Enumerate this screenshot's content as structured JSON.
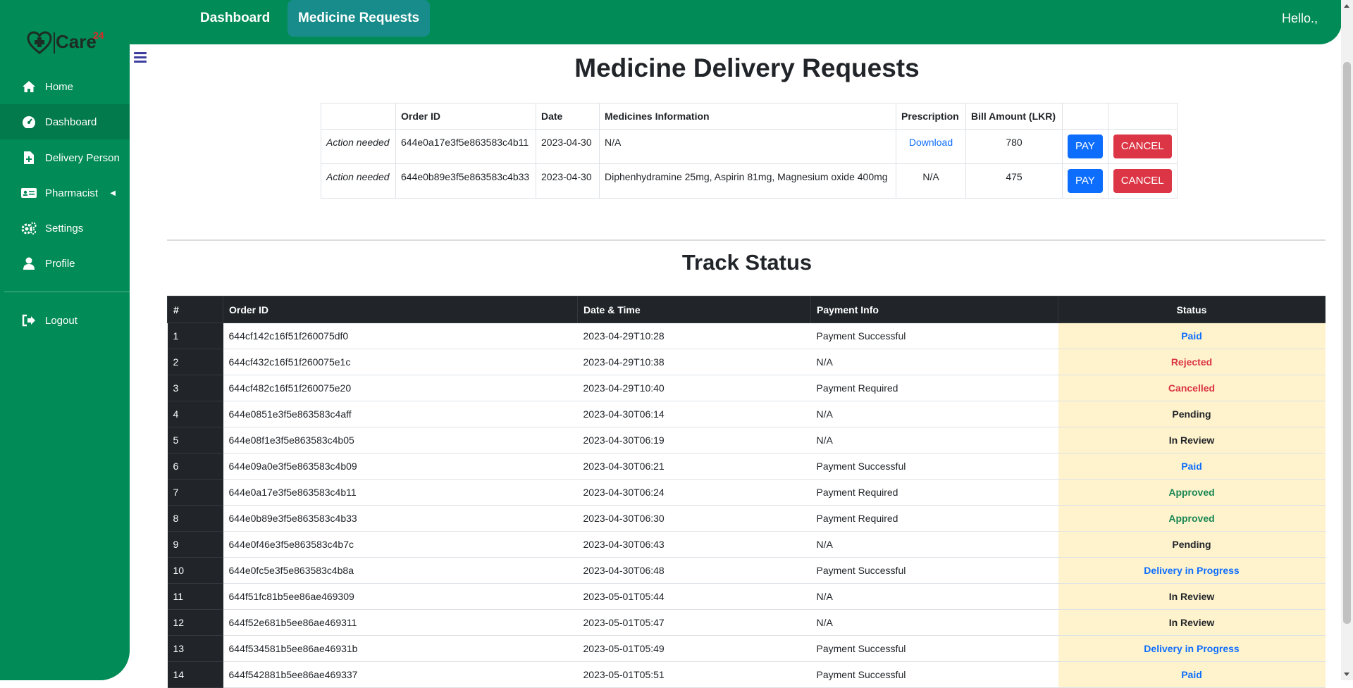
{
  "topnav": {
    "tabs": [
      "Dashboard",
      "Medicine Requests"
    ],
    "greeting": "Hello.,"
  },
  "brand": {
    "name": "Care",
    "suffix": "24"
  },
  "sidebar": {
    "items": [
      {
        "label": "Home",
        "icon": "home-icon"
      },
      {
        "label": "Dashboard",
        "icon": "dashboard-icon"
      },
      {
        "label": "Delivery Person",
        "icon": "file-plus-icon"
      },
      {
        "label": "Pharmacist",
        "icon": "id-card-icon"
      },
      {
        "label": "Settings",
        "icon": "gears-icon"
      },
      {
        "label": "Profile",
        "icon": "user-icon"
      }
    ],
    "logout": "Logout"
  },
  "page": {
    "title": "Medicine Delivery Requests"
  },
  "requests": {
    "headers": [
      "",
      "Order ID",
      "Date",
      "Medicines Information",
      "Prescription",
      "Bill Amount (LKR)",
      "",
      ""
    ],
    "rows": [
      {
        "action": "Action needed",
        "order_id": "644e0a17e3f5e863583c4b11",
        "date": "2023-04-30",
        "medicines": "N/A",
        "prescription": "Download",
        "amount": "780",
        "pay": "PAY",
        "cancel": "CANCEL"
      },
      {
        "action": "Action needed",
        "order_id": "644e0b89e3f5e863583c4b33",
        "date": "2023-04-30",
        "medicines": "Diphenhydramine 25mg, Aspirin 81mg, Magnesium oxide 400mg",
        "prescription": "N/A",
        "amount": "475",
        "pay": "PAY",
        "cancel": "CANCEL"
      }
    ]
  },
  "track": {
    "title": "Track Status",
    "headers": [
      "#",
      "Order ID",
      "Date & Time",
      "Payment Info",
      "Status"
    ],
    "rows": [
      {
        "n": "1",
        "id": "644cf142c16f51f260075df0",
        "dt": "2023-04-29T10:28",
        "pay": "Payment Successful",
        "status": "Paid"
      },
      {
        "n": "2",
        "id": "644cf432c16f51f260075e1c",
        "dt": "2023-04-29T10:38",
        "pay": "N/A",
        "status": "Rejected"
      },
      {
        "n": "3",
        "id": "644cf482c16f51f260075e20",
        "dt": "2023-04-29T10:40",
        "pay": "Payment Required",
        "status": "Cancelled"
      },
      {
        "n": "4",
        "id": "644e0851e3f5e863583c4aff",
        "dt": "2023-04-30T06:14",
        "pay": "N/A",
        "status": "Pending"
      },
      {
        "n": "5",
        "id": "644e08f1e3f5e863583c4b05",
        "dt": "2023-04-30T06:19",
        "pay": "N/A",
        "status": "In Review"
      },
      {
        "n": "6",
        "id": "644e09a0e3f5e863583c4b09",
        "dt": "2023-04-30T06:21",
        "pay": "Payment Successful",
        "status": "Paid"
      },
      {
        "n": "7",
        "id": "644e0a17e3f5e863583c4b11",
        "dt": "2023-04-30T06:24",
        "pay": "Payment Required",
        "status": "Approved"
      },
      {
        "n": "8",
        "id": "644e0b89e3f5e863583c4b33",
        "dt": "2023-04-30T06:30",
        "pay": "Payment Required",
        "status": "Approved"
      },
      {
        "n": "9",
        "id": "644e0f46e3f5e863583c4b7c",
        "dt": "2023-04-30T06:43",
        "pay": "N/A",
        "status": "Pending"
      },
      {
        "n": "10",
        "id": "644e0fc5e3f5e863583c4b8a",
        "dt": "2023-04-30T06:48",
        "pay": "Payment Successful",
        "status": "Delivery in Progress"
      },
      {
        "n": "11",
        "id": "644f51fc81b5ee86ae469309",
        "dt": "2023-05-01T05:44",
        "pay": "N/A",
        "status": "In Review"
      },
      {
        "n": "12",
        "id": "644f52e681b5ee86ae469311",
        "dt": "2023-05-01T05:47",
        "pay": "N/A",
        "status": "In Review"
      },
      {
        "n": "13",
        "id": "644f534581b5ee86ae46931b",
        "dt": "2023-05-01T05:49",
        "pay": "Payment Successful",
        "status": "Delivery in Progress"
      },
      {
        "n": "14",
        "id": "644f542881b5ee86ae469337",
        "dt": "2023-05-01T05:51",
        "pay": "Payment Successful",
        "status": "Paid"
      }
    ]
  },
  "status_colors": {
    "Paid": "#0d6efd",
    "Rejected": "#dc3545",
    "Cancelled": "#dc3545",
    "Pending": "#212529",
    "In Review": "#212529",
    "Approved": "#198754",
    "Delivery in Progress": "#0d6efd"
  },
  "colors": {
    "brand_green": "#018b56",
    "active_tab": "#178c8a"
  }
}
